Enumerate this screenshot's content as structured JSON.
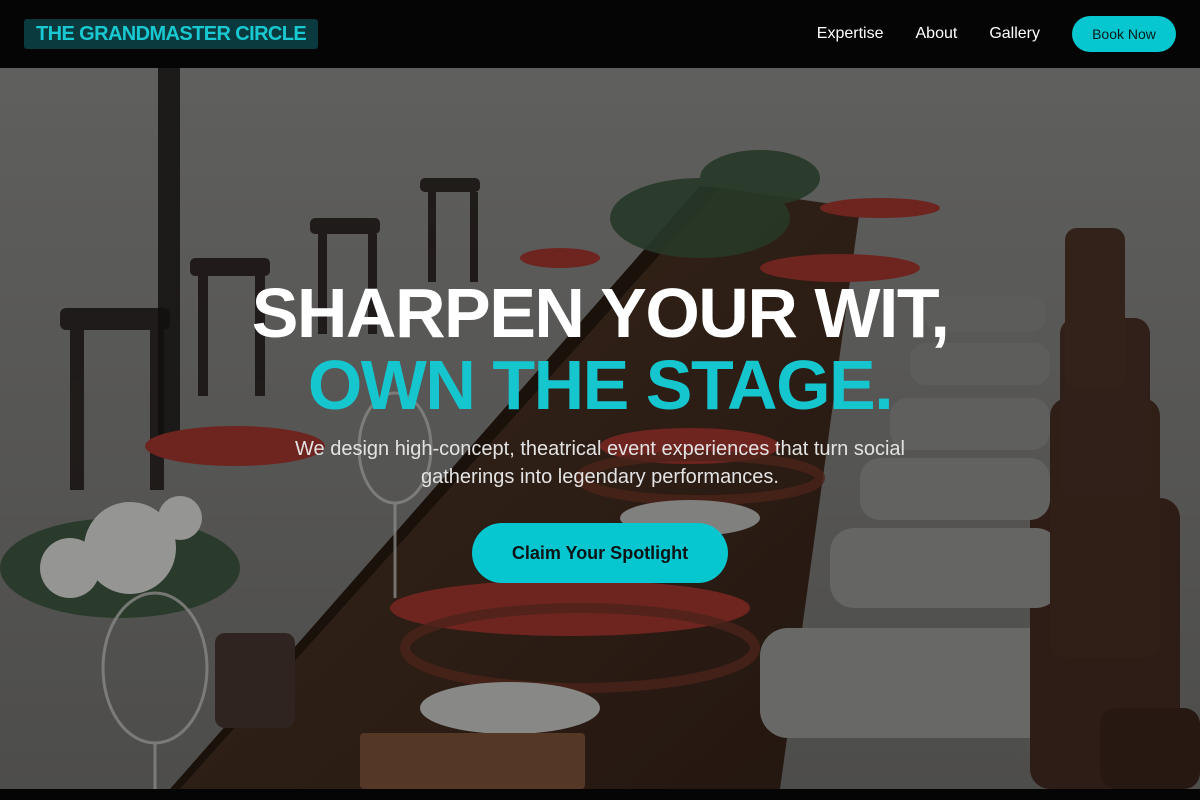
{
  "brand": {
    "logo_text": "THE GRANDMASTER CIRCLE"
  },
  "nav": {
    "links": [
      "Expertise",
      "About",
      "Gallery"
    ],
    "cta_label": "Book Now"
  },
  "hero": {
    "headline_line1": "SHARPEN YOUR WIT,",
    "headline_line2": "OWN THE STAGE.",
    "subtitle": "We design high-concept, theatrical event experiences that turn social gatherings into legendary performances.",
    "cta_label": "Claim Your Spotlight",
    "background": "dinner-table-with-chairs-photo"
  },
  "colors": {
    "accent": "#06c7cf",
    "nav_background": "#050505",
    "logo_background": "#0b3a3e"
  }
}
